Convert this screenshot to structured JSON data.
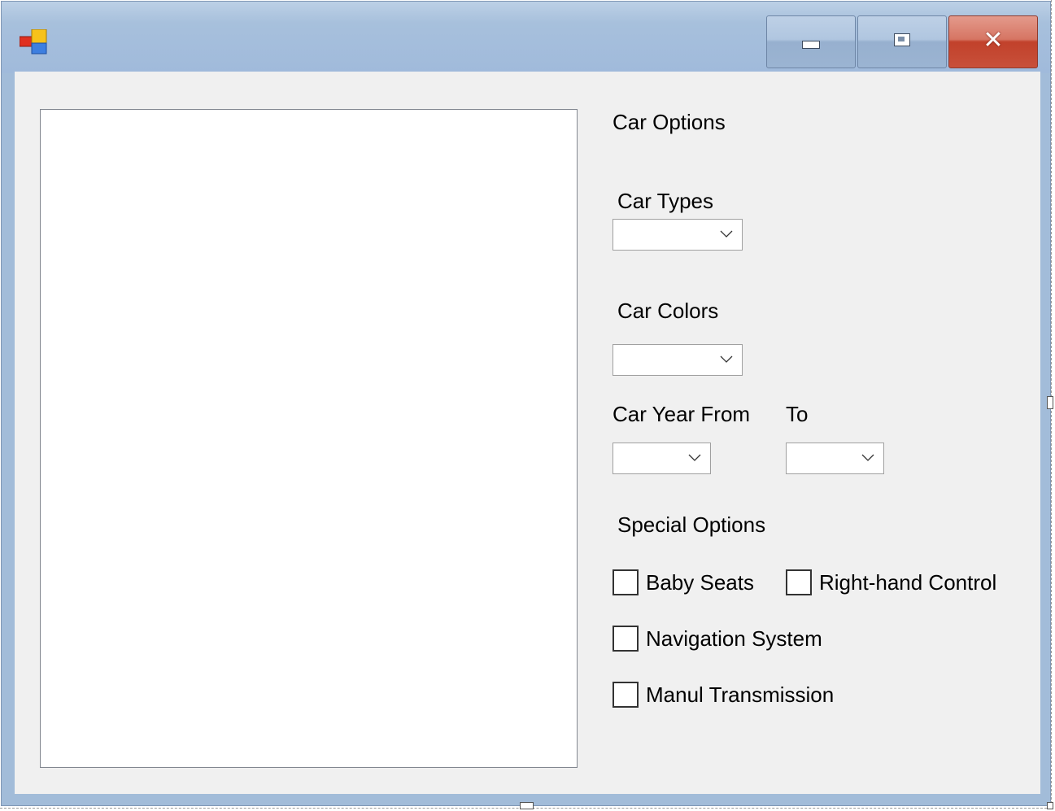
{
  "window": {
    "icon": "windows-forms-app-icon",
    "caption_buttons": {
      "minimize_icon": "minimize-icon",
      "maximize_icon": "maximize-icon",
      "close_icon": "close-icon",
      "close_glyph": "✕"
    },
    "colors": {
      "frame": "#a2bcd9",
      "client": "#f0f0f0",
      "close_button": "#c1412b"
    }
  },
  "form": {
    "section_title": "Car Options",
    "car_types": {
      "label": "Car Types",
      "selected": ""
    },
    "car_colors": {
      "label": "Car Colors",
      "selected": ""
    },
    "year_from": {
      "label": "Car Year From",
      "selected": ""
    },
    "year_to": {
      "label": "To",
      "selected": ""
    },
    "special_options": {
      "label": "Special Options",
      "items": [
        {
          "label": "Baby Seats",
          "checked": false
        },
        {
          "label": "Right-hand Control",
          "checked": false
        },
        {
          "label": "Navigation System",
          "checked": false
        },
        {
          "label": "Manul Transmission",
          "checked": false
        }
      ]
    },
    "results_list": {
      "items": []
    }
  }
}
